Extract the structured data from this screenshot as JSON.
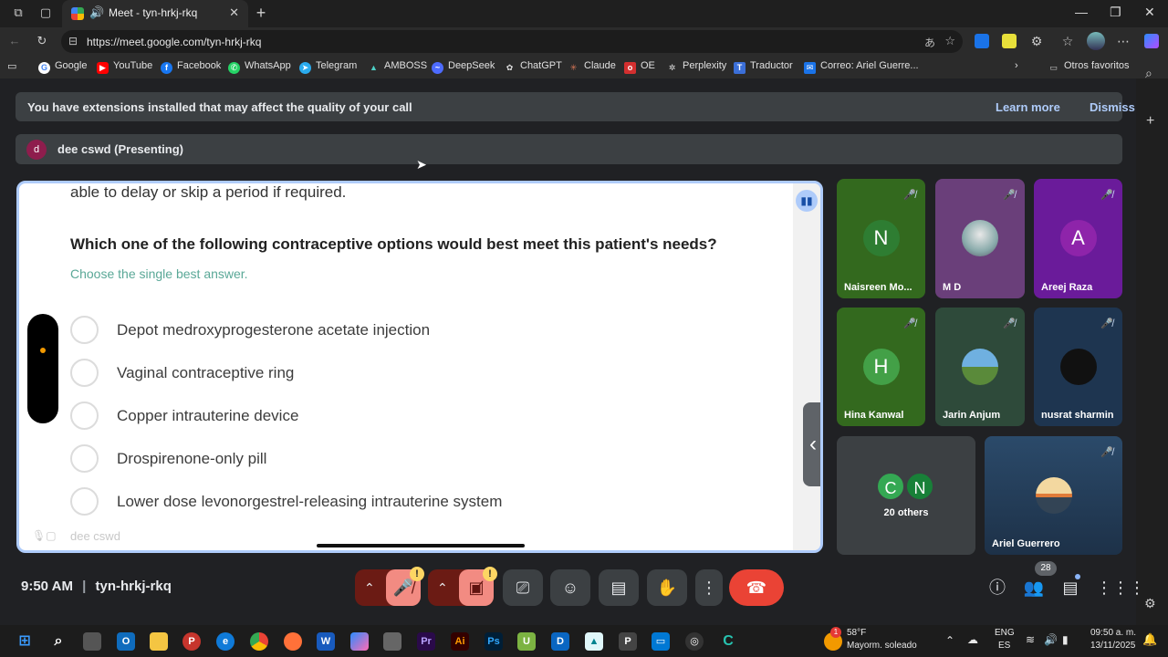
{
  "browser": {
    "tab_title": "Meet - tyn-hrkj-rkq",
    "url": "https://meet.google.com/tyn-hrkj-rkq",
    "bookmarks": [
      "Google",
      "YouTube",
      "Facebook",
      "WhatsApp",
      "Telegram",
      "AMBOSS",
      "DeepSeek",
      "ChatGPT",
      "Claude",
      "OE",
      "Perplexity",
      "Traductor",
      "Correo: Ariel Guerre..."
    ],
    "other_favorites": "Otros favoritos"
  },
  "banner": {
    "message": "You have extensions installed that may affect the quality of your call",
    "learn_more": "Learn more",
    "dismiss": "Dismiss"
  },
  "presenter": {
    "initial": "d",
    "label": "dee cswd (Presenting)"
  },
  "screen": {
    "prev_text": "able to delay or skip a period if required.",
    "question": "Which one of the following contraceptive options would best meet this patient's needs?",
    "hint": "Choose the single best answer.",
    "options": [
      "Depot medroxyprogesterone acetate injection",
      "Vaginal contraceptive ring",
      "Copper intrauterine device",
      "Drospirenone-only pill",
      "Lower dose levonorgestrel-releasing intrauterine system"
    ],
    "footer_name": "dee cswd"
  },
  "participants": [
    {
      "name": "Naisreen Mo...",
      "initial": "N",
      "bg": "#33691e",
      "avatar_bg": "#2e7d32"
    },
    {
      "name": "M D",
      "initial": "",
      "bg": "#6a3f7a",
      "avatar_bg": ""
    },
    {
      "name": "Areej Raza",
      "initial": "A",
      "bg": "#6a1b9a",
      "avatar_bg": "#8e24aa"
    },
    {
      "name": "Hina Kanwal",
      "initial": "H",
      "bg": "#33691e",
      "avatar_bg": "#43a047"
    },
    {
      "name": "Jarin Anjum",
      "initial": "",
      "bg": "#2e4a3a",
      "avatar_bg": ""
    },
    {
      "name": "nusrat sharmin",
      "initial": "",
      "bg": "#1e3550",
      "avatar_bg": ""
    }
  ],
  "others": {
    "c": "C",
    "n": "N",
    "label": "20 others"
  },
  "ariel": {
    "name": "Ariel Guerrero"
  },
  "meeting": {
    "time": "9:50 AM",
    "code": "tyn-hrkj-rkq",
    "people_count": "28"
  },
  "taskbar": {
    "weather_temp": "58°F",
    "weather_desc": "Mayorm. soleado",
    "lang1": "ENG",
    "lang2": "ES",
    "clock_time": "09:50 a. m.",
    "clock_date": "13/11/2025",
    "weather_badge": "1"
  }
}
